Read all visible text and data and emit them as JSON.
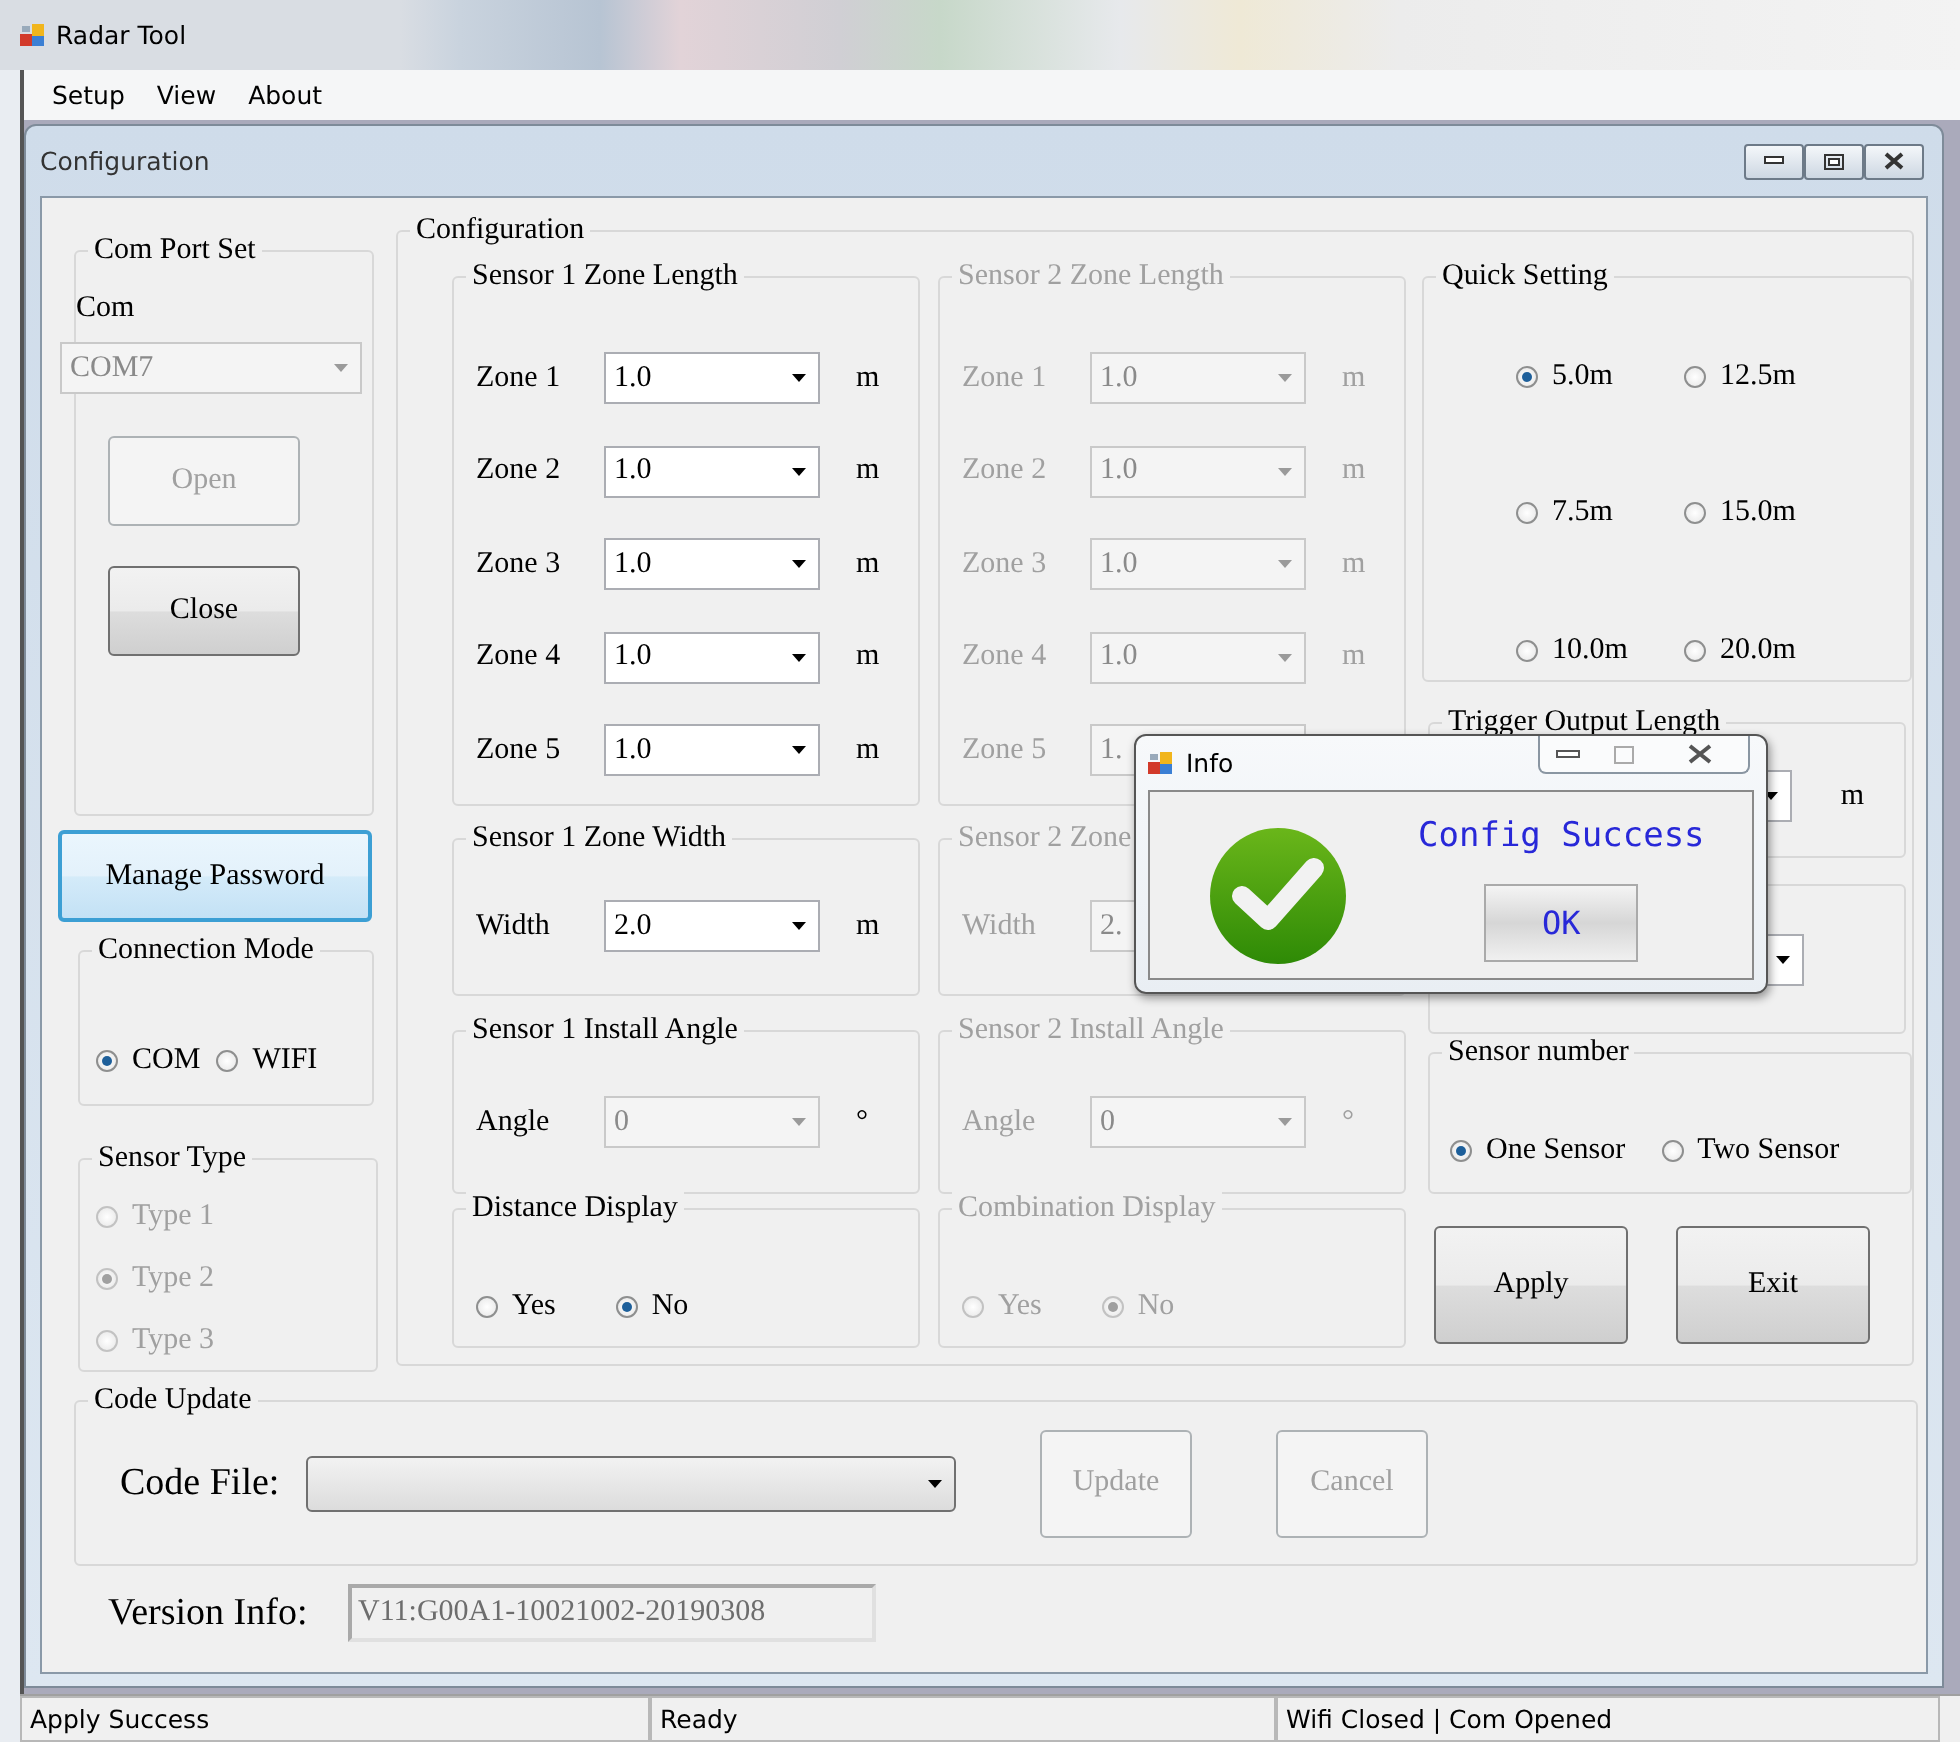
{
  "window": {
    "title": "Radar Tool"
  },
  "menu": [
    "Setup",
    "View",
    "About"
  ],
  "child_window": {
    "title": "Configuration"
  },
  "com_port_set": {
    "title": "Com Port Set",
    "label": "Com",
    "port": "COM7",
    "port_disabled": true,
    "buttons": [
      {
        "label": "Open",
        "disabled": true
      },
      {
        "label": "Close",
        "disabled": false
      }
    ]
  },
  "manage_password": {
    "label": "Manage Password",
    "focused": true
  },
  "connection_mode": {
    "title": "Connection Mode",
    "disabled": false,
    "options": [
      {
        "label": "COM",
        "selected": true
      },
      {
        "label": "WIFI",
        "selected": false
      }
    ]
  },
  "sensor_type": {
    "title": "Sensor Type",
    "disabled": true,
    "options": [
      {
        "label": "Type 1",
        "selected": false
      },
      {
        "label": "Type 2",
        "selected": true
      },
      {
        "label": "Type 3",
        "selected": false
      }
    ]
  },
  "configuration": {
    "title": "Configuration",
    "sensors": [
      {
        "disabled": false,
        "zone_length": {
          "title": "Sensor 1 Zone Length",
          "zones": [
            {
              "label": "Zone 1",
              "value": "1.0",
              "unit": "m"
            },
            {
              "label": "Zone 2",
              "value": "1.0",
              "unit": "m"
            },
            {
              "label": "Zone 3",
              "value": "1.0",
              "unit": "m"
            },
            {
              "label": "Zone 4",
              "value": "1.0",
              "unit": "m"
            },
            {
              "label": "Zone 5",
              "value": "1.0",
              "unit": "m"
            }
          ]
        },
        "zone_width": {
          "title": "Sensor 1 Zone Width",
          "label": "Width",
          "value": "2.0",
          "unit": "m"
        },
        "install_angle": {
          "title": "Sensor 1 Install Angle",
          "label": "Angle",
          "value": "0",
          "unit": "°",
          "disabled": true
        },
        "display": {
          "title": "Distance Display",
          "options": [
            {
              "label": "Yes",
              "selected": false
            },
            {
              "label": "No",
              "selected": true
            }
          ]
        }
      },
      {
        "disabled": true,
        "zone_length": {
          "title": "Sensor 2 Zone Length",
          "zones": [
            {
              "label": "Zone 1",
              "value": "1.0",
              "unit": "m"
            },
            {
              "label": "Zone 2",
              "value": "1.0",
              "unit": "m"
            },
            {
              "label": "Zone 3",
              "value": "1.0",
              "unit": "m"
            },
            {
              "label": "Zone 4",
              "value": "1.0",
              "unit": "m"
            },
            {
              "label": "Zone 5",
              "value": "1."
            }
          ]
        },
        "zone_width": {
          "title": "Sensor 2 Zone",
          "label": "Width",
          "value": "2."
        },
        "install_angle": {
          "title": "Sensor 2 Install Angle",
          "label": "Angle",
          "value": "0",
          "unit": "°",
          "disabled": true
        },
        "display": {
          "title": "Combination Display",
          "options": [
            {
              "label": "Yes",
              "selected": false
            },
            {
              "label": "No",
              "selected": true
            }
          ]
        }
      }
    ],
    "quick_setting": {
      "title": "Quick Setting",
      "options": [
        {
          "label": "5.0m",
          "selected": true
        },
        {
          "label": "12.5m",
          "selected": false
        },
        {
          "label": "7.5m",
          "selected": false
        },
        {
          "label": "15.0m",
          "selected": false
        },
        {
          "label": "10.0m",
          "selected": false
        },
        {
          "label": "20.0m",
          "selected": false
        }
      ]
    },
    "trigger_output_length": {
      "title": "Trigger Output Length",
      "unit": "m"
    },
    "sensor_number": {
      "title": "Sensor number",
      "options": [
        {
          "label": "One Sensor",
          "selected": true
        },
        {
          "label": "Two Sensor",
          "selected": false
        }
      ]
    },
    "buttons": [
      "Apply",
      "Exit"
    ]
  },
  "code_update": {
    "title": "Code Update",
    "label": "Code File:",
    "buttons": [
      {
        "label": "Update",
        "disabled": true
      },
      {
        "label": "Cancel",
        "disabled": true
      }
    ]
  },
  "version_info": {
    "label": "Version Info:",
    "value": "V11:G00A1-10021002-20190308"
  },
  "status_bar": [
    "Apply Success",
    "Ready",
    "Wifi Closed | Com Opened"
  ],
  "dialog": {
    "title": "Info",
    "message": "Config Success",
    "button": "OK"
  }
}
